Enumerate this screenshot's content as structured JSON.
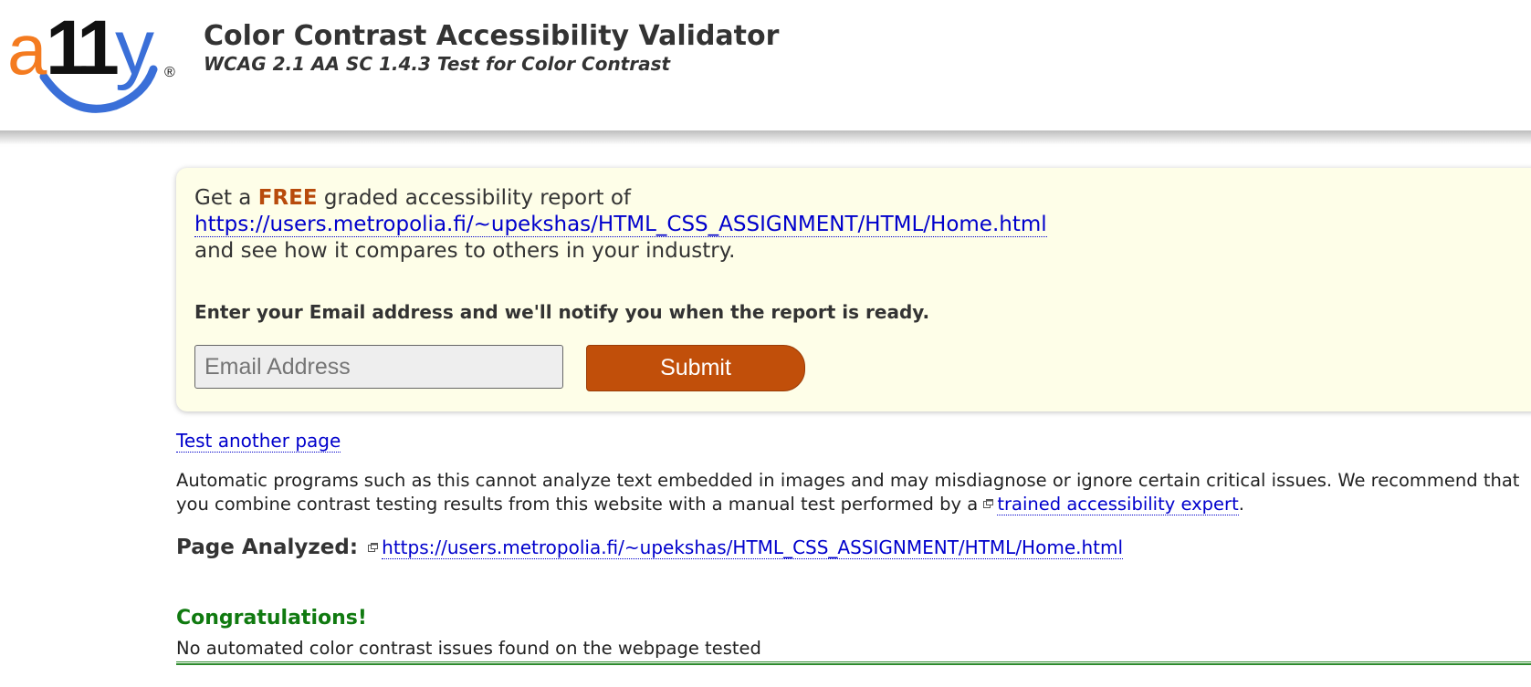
{
  "header": {
    "logo_text": "a11y",
    "logo_mark": "®",
    "title": "Color Contrast Accessibility Validator",
    "subtitle": "WCAG 2.1 AA SC 1.4.3 Test for Color Contrast"
  },
  "promo": {
    "get_a": "Get a ",
    "free": "FREE",
    "graded_text": " graded accessibility report of",
    "url": "https://users.metropolia.fi/~upekshas/HTML_CSS_ASSIGNMENT/HTML/Home.html",
    "compare_text": "and see how it compares to others in your industry.",
    "notify_text": "Enter your Email address and we'll notify you when the report is ready.",
    "email_placeholder": "Email Address",
    "email_value": "",
    "submit_label": "Submit"
  },
  "test_another_label": "Test another page",
  "disclaimer": {
    "text_before": "Automatic programs such as this cannot analyze text embedded in images and may misdiagnose or ignore certain critical issues. We recommend that you combine contrast testing results from this website with a manual test performed by a ",
    "expert_link": "trained accessibility expert",
    "text_after": "."
  },
  "page_analyzed": {
    "label": "Page Analyzed:",
    "url": "https://users.metropolia.fi/~upekshas/HTML_CSS_ASSIGNMENT/HTML/Home.html"
  },
  "result": {
    "title": "Congratulations!",
    "message": "No automated color contrast issues found on the webpage tested"
  },
  "colors": {
    "brand_orange": "#f47b20",
    "brand_blue": "#3a6fd8",
    "accent_orange": "#c14f0a",
    "link_blue": "#0000cc",
    "success_green": "#107a10",
    "promo_background": "#fefee8"
  },
  "icons": {
    "external_link": "external-link-icon"
  }
}
